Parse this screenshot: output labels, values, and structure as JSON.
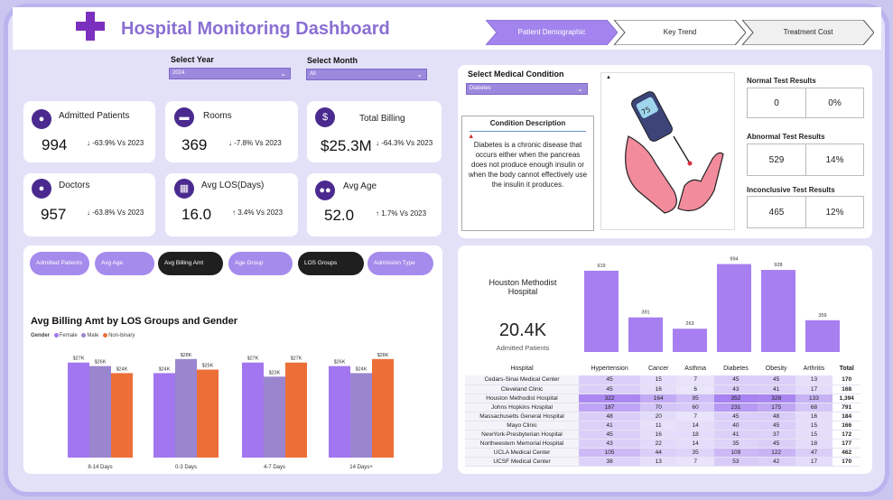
{
  "header": {
    "title": "Hospital Monitoring Dashboard",
    "tabs": [
      {
        "label": "Patient Demographic",
        "active": true
      },
      {
        "label": "Key Trend",
        "active": false
      },
      {
        "label": "Treatment Cost",
        "active": false
      }
    ]
  },
  "filters": {
    "year_label": "Select Year",
    "year_value": "2024",
    "month_label": "Select Month",
    "month_value": "All",
    "condition_label": "Select Medical Condition",
    "condition_value": "Diabetes"
  },
  "kpis": [
    {
      "label": "Admitted Patients",
      "value": "994",
      "delta": "↓ -63.9% Vs 2023",
      "icon": "patient-icon"
    },
    {
      "label": "Rooms",
      "value": "369",
      "delta": "↓ -7.8% Vs 2023",
      "icon": "bed-icon"
    },
    {
      "label": "Total  Billing",
      "value": "$25.3M",
      "delta": "↓ -64.3% Vs 2023",
      "icon": "money-bag-icon"
    },
    {
      "label": "Doctors",
      "value": "957",
      "delta": "↓ -63.8% Vs 2023",
      "icon": "doctor-icon"
    },
    {
      "label": "Avg LOS(Days)",
      "value": "16.0",
      "delta": "↑ 3.4% Vs 2023",
      "icon": "calendar-icon"
    },
    {
      "label": "Avg Age",
      "value": "52.0",
      "delta": "↑ 1.7% Vs 2023",
      "icon": "people-icon"
    }
  ],
  "condition": {
    "desc_title": "Condition Description",
    "desc_text": "Diabetes is a chronic disease that occurs either when the pancreas does not produce enough insulin or when the body cannot effectively use the insulin it produces."
  },
  "tests": {
    "normal_label": "Normal Test Results",
    "normal_count": "0",
    "normal_pct": "0%",
    "abnormal_label": "Abnormal Test Results",
    "abnormal_count": "529",
    "abnormal_pct": "14%",
    "inconclusive_label": "Inconclusive Test Results",
    "inconclusive_count": "465",
    "inconclusive_pct": "12%"
  },
  "buttons": [
    {
      "label": "Admitted Patients",
      "active": false
    },
    {
      "label": "Avg Age",
      "active": false
    },
    {
      "label": "Avg Billing Amt",
      "active": true
    },
    {
      "label": "Age Group",
      "active": false
    },
    {
      "label": "LOS Groups",
      "active": true
    },
    {
      "label": "Admission Type",
      "active": false
    }
  ],
  "colors": {
    "female": "#a276f0",
    "male": "#9a85cf",
    "nonbinary": "#ec6f38",
    "accent": "#8a6fd3",
    "condition_bar": "#a77ff0"
  },
  "chart_data": [
    {
      "type": "bar",
      "title": "Avg Billing Amt by LOS Groups and Gender",
      "legend_title": "Gender",
      "categories": [
        "8-14 Days",
        "0-3 Days",
        "4-7 Days",
        "14 Days+"
      ],
      "series": [
        {
          "name": "Female",
          "values": [
            27,
            24,
            27,
            26
          ],
          "labels": [
            "$27K",
            "$24K",
            "$27K",
            "$26K"
          ]
        },
        {
          "name": "Male",
          "values": [
            26,
            28,
            23,
            24
          ],
          "labels": [
            "$26K",
            "$28K",
            "$23K",
            "$24K"
          ]
        },
        {
          "name": "Non-binary",
          "values": [
            24,
            25,
            27,
            28
          ],
          "labels": [
            "$24K",
            "$25K",
            "$27K",
            "$28K"
          ]
        }
      ],
      "ylim": [
        0,
        30
      ],
      "grid": false,
      "legend_position": "top-left"
    },
    {
      "type": "bar",
      "categories": [
        "Hypertension",
        "Cancer",
        "Asthma",
        "Diabetes",
        "Obesity",
        "Arthritis"
      ],
      "values": [
        919,
        391,
        263,
        994,
        928,
        359
      ],
      "ylim": [
        0,
        1000
      ],
      "grid": false
    }
  ],
  "selected_hospital": {
    "name": "Houston Methodist Hospital",
    "value": "20.4K",
    "label": "Admitted Patients"
  },
  "table": {
    "hospital_header": "Hospital",
    "total_header": "Total",
    "rows": [
      {
        "hospital": "Cedars-Sinai Medical Center",
        "v": [
          45,
          15,
          7,
          45,
          45,
          13
        ],
        "total": "170"
      },
      {
        "hospital": "Cleveland Clinic",
        "v": [
          45,
          16,
          6,
          43,
          41,
          17
        ],
        "total": "168"
      },
      {
        "hospital": "Houston Methodist Hospital",
        "v": [
          322,
          164,
          95,
          352,
          328,
          133
        ],
        "total": "1,394"
      },
      {
        "hospital": "Johns Hopkins Hospital",
        "v": [
          187,
          70,
          60,
          231,
          175,
          68
        ],
        "total": "791"
      },
      {
        "hospital": "Massachusetts General Hospital",
        "v": [
          48,
          20,
          7,
          45,
          48,
          16
        ],
        "total": "184"
      },
      {
        "hospital": "Mayo Clinic",
        "v": [
          41,
          11,
          14,
          40,
          45,
          15
        ],
        "total": "166"
      },
      {
        "hospital": "NewYork-Presbyterian Hospital",
        "v": [
          45,
          16,
          18,
          41,
          37,
          15
        ],
        "total": "172"
      },
      {
        "hospital": "Northwestern Memorial Hospital",
        "v": [
          43,
          22,
          14,
          35,
          45,
          18
        ],
        "total": "177"
      },
      {
        "hospital": "UCLA Medical Center",
        "v": [
          105,
          44,
          35,
          109,
          122,
          47
        ],
        "total": "462"
      },
      {
        "hospital": "UCSF Medical Center",
        "v": [
          38,
          13,
          7,
          53,
          42,
          17
        ],
        "total": "170"
      }
    ]
  }
}
